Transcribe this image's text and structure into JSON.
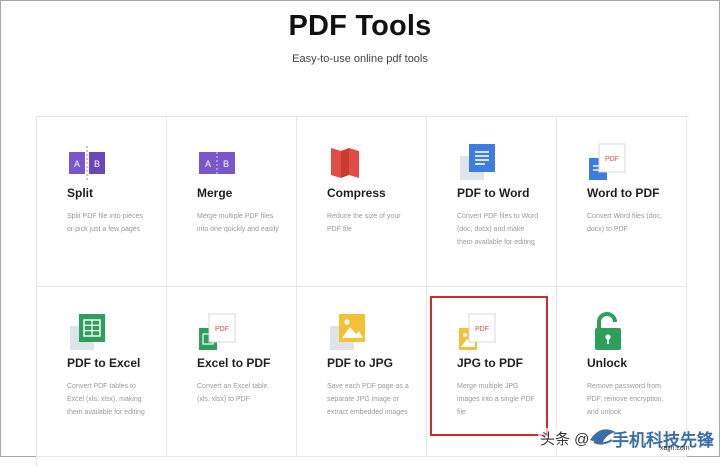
{
  "header": {
    "title": "PDF Tools",
    "subtitle": "Easy-to-use online pdf tools"
  },
  "tools": [
    {
      "name": "Split",
      "desc": "Split PDF file into pieces or pick just a few pages",
      "icon": "split-icon"
    },
    {
      "name": "Merge",
      "desc": "Merge multiple PDF files into one quickly and easily",
      "icon": "merge-icon"
    },
    {
      "name": "Compress",
      "desc": "Reduce the size of your PDF file",
      "icon": "compress-icon"
    },
    {
      "name": "PDF to Word",
      "desc": "Convert PDF files to Word (doc, docx) and make them available for editing",
      "icon": "word-doc-icon"
    },
    {
      "name": "Word to PDF",
      "desc": "Convert Word files (doc, docx) to PDF",
      "icon": "word-to-pdf-icon"
    },
    {
      "name": "PDF to Excel",
      "desc": "Convert PDF tables to Excel (xls, xlsx), making them available for editing",
      "icon": "excel-sheet-icon"
    },
    {
      "name": "Excel to PDF",
      "desc": "Convert an Excel table (xls, xlsx) to PDF",
      "icon": "excel-to-pdf-icon"
    },
    {
      "name": "PDF to JPG",
      "desc": "Save each PDF page as a separate JPG image or extract embedded images",
      "icon": "image-icon"
    },
    {
      "name": "JPG to PDF",
      "desc": "Merge multiple JPG images into a single PDF file",
      "icon": "jpg-to-pdf-icon"
    },
    {
      "name": "Unlock",
      "desc": "Remove password from PDF, remove encryption, and unlock",
      "icon": "unlock-icon"
    }
  ],
  "icon_labels": {
    "a": "A",
    "b": "B",
    "pdf": "PDF"
  },
  "colors": {
    "purple": "#7a57c9",
    "red": "#e14b48",
    "blue": "#3d7de0",
    "green": "#2e9f5b",
    "yellow": "#f2c234",
    "highlight": "#c9302c"
  },
  "watermark": {
    "left_text": "头条 @",
    "right_text": "手机科技先锋",
    "site_url": "xajjn.com"
  }
}
